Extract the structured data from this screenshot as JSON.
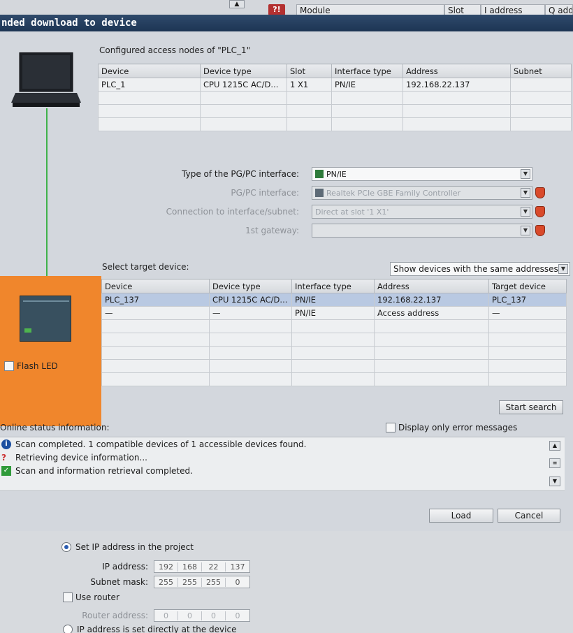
{
  "top": {
    "columns": [
      "Module",
      "Slot",
      "I address",
      "Q addr"
    ]
  },
  "dialog_title": "nded download to device",
  "configured": {
    "label": "Configured access nodes of \"PLC_1\"",
    "headers": [
      "Device",
      "Device type",
      "Slot",
      "Interface type",
      "Address",
      "Subnet"
    ],
    "rows": [
      [
        "PLC_1",
        "CPU 1215C AC/D...",
        "1 X1",
        "PN/IE",
        "192.168.22.137",
        ""
      ]
    ]
  },
  "interface": {
    "type_label": "Type of the PG/PC interface:",
    "type_value": "PN/IE",
    "pgpc_label": "PG/PC interface:",
    "pgpc_value": "Realtek PCIe GBE Family Controller",
    "conn_label": "Connection to interface/subnet:",
    "conn_value": "Direct at slot '1 X1'",
    "gateway_label": "1st gateway:",
    "gateway_value": ""
  },
  "target": {
    "label": "Select target device:",
    "filter": "Show devices with the same addresses",
    "headers": [
      "Device",
      "Device type",
      "Interface type",
      "Address",
      "Target device"
    ],
    "rows": [
      [
        "PLC_137",
        "CPU 1215C AC/D...",
        "PN/IE",
        "192.168.22.137",
        "PLC_137"
      ],
      [
        "—",
        "—",
        "PN/IE",
        "Access address",
        "—"
      ]
    ]
  },
  "flash_led": "Flash LED",
  "start_search": "Start search",
  "online_status": "Online status information:",
  "only_errors": "Display only error messages",
  "messages": [
    {
      "icon": "info-icon",
      "text": "Scan completed. 1 compatible devices of 1 accessible devices found."
    },
    {
      "icon": "question-icon",
      "text": "Retrieving device information..."
    },
    {
      "icon": "check-icon",
      "text": "Scan and information retrieval completed."
    }
  ],
  "load": "Load",
  "cancel": "Cancel",
  "ipsettings": {
    "set_ip": "Set IP address in the project",
    "ip_label": "IP address:",
    "ip": [
      "192",
      "168",
      "22",
      "137"
    ],
    "mask_label": "Subnet mask:",
    "mask": [
      "255",
      "255",
      "255",
      "0"
    ],
    "use_router": "Use router",
    "router_label": "Router address:",
    "router": [
      "0",
      "0",
      "0",
      "0"
    ],
    "direct": "IP address is set directly at the device"
  }
}
